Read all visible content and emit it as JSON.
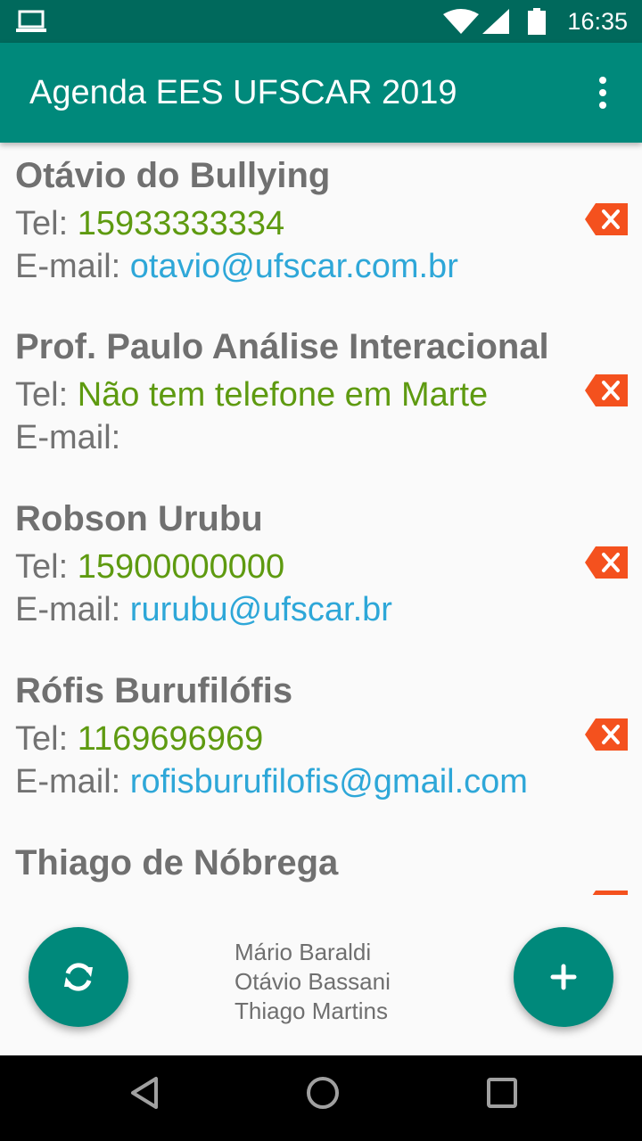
{
  "status_bar": {
    "time": "16:35",
    "icons": [
      "laptop-icon",
      "wifi-icon",
      "signal-icon",
      "battery-icon"
    ]
  },
  "app_bar": {
    "title": "Agenda EES UFSCAR 2019",
    "overflow_icon": "more-vert-icon"
  },
  "labels": {
    "tel": "Tel: ",
    "email": "E-mail: "
  },
  "contacts": [
    {
      "name": "Otávio do Bullying",
      "tel": "15933333334",
      "email": "otavio@ufscar.com.br"
    },
    {
      "name": "Prof. Paulo Análise Interacional",
      "tel": "Não tem telefone em Marte",
      "email": ""
    },
    {
      "name": "Robson Urubu",
      "tel": "15900000000",
      "email": "rurubu@ufscar.br"
    },
    {
      "name": "Rófis Burufilófis",
      "tel": "1169696969",
      "email": "rofisburufilofis@gmail.com"
    },
    {
      "name": "Thiago de Nóbrega",
      "tel": "",
      "email": ""
    }
  ],
  "credits": [
    "Mário Baraldi",
    "Otávio Bassani",
    "Thiago Martins"
  ],
  "colors": {
    "primary": "#00897b",
    "primary_dark": "#00695c",
    "phone": "#5e9a10",
    "email": "#2ea7d8",
    "delete": "#f4511e"
  },
  "fabs": {
    "refresh_icon": "refresh-icon",
    "add_icon": "plus-icon"
  },
  "nav": [
    "back-icon",
    "home-icon",
    "recents-icon"
  ]
}
